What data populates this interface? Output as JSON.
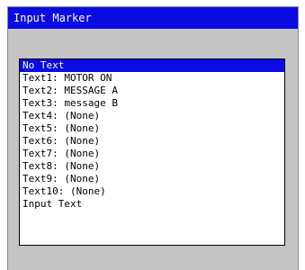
{
  "window": {
    "title": "Input Marker"
  },
  "list": {
    "selected_index": 0,
    "items": [
      "No Text",
      "Text1: MOTOR ON",
      "Text2: MESSAGE A",
      "Text3: message B",
      "Text4: (None)",
      "Text5: (None)",
      "Text6: (None)",
      "Text7: (None)",
      "Text8: (None)",
      "Text9: (None)",
      "Text10: (None)",
      "Input Text"
    ]
  },
  "colors": {
    "titlebar_bg": "#0a0ae2",
    "selection_bg": "#0a0ae2",
    "dialog_bg": "#c4c4c4"
  }
}
